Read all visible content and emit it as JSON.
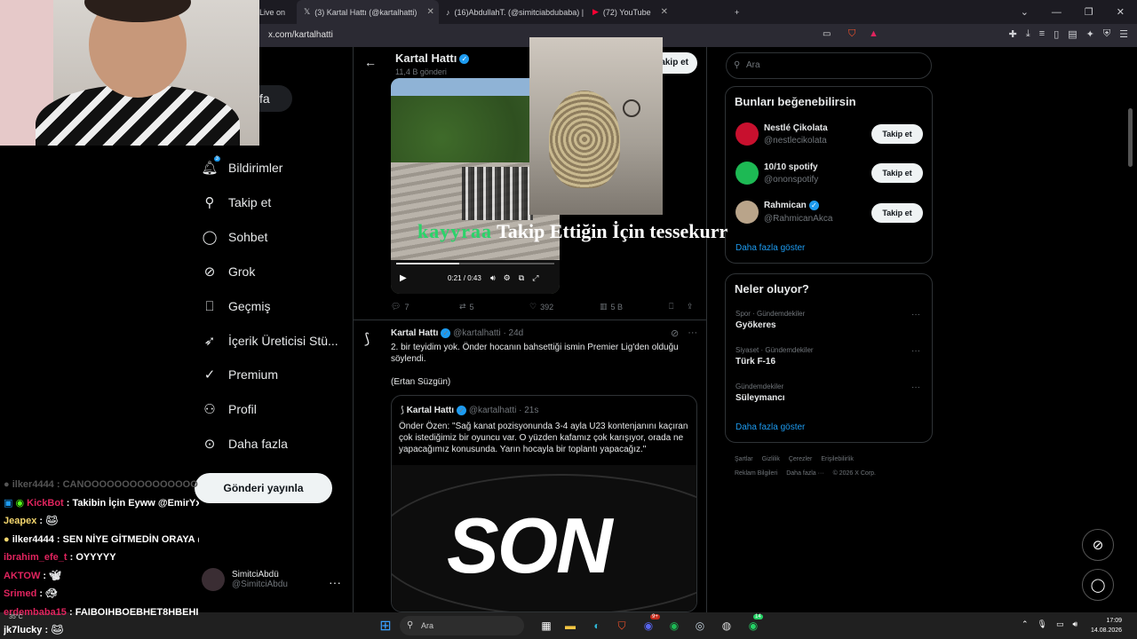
{
  "browser": {
    "tabs": [
      {
        "label": "Live on",
        "active": false
      },
      {
        "label": "(3) Kartal Hattı (@kartalhatti)",
        "active": true
      },
      {
        "label": "(16)AbdullahT. (@simitciabdubaba) |",
        "active": false
      },
      {
        "label": "(72) YouTube",
        "active": false
      }
    ],
    "url": "x.com/kartalhatti"
  },
  "nav": {
    "home": "yfa",
    "items": [
      {
        "label": "Bildirimler",
        "icon": "bell-icon"
      },
      {
        "label": "Takip et",
        "icon": "person-plus-icon"
      },
      {
        "label": "Sohbet",
        "icon": "chat-icon"
      },
      {
        "label": "Grok",
        "icon": "grok-icon"
      },
      {
        "label": "Geçmiş",
        "icon": "bookmark-icon"
      },
      {
        "label": "İçerik Üreticisi Stü...",
        "icon": "rocket-icon"
      },
      {
        "label": "Premium",
        "icon": "verified-icon"
      },
      {
        "label": "Profil",
        "icon": "person-icon"
      },
      {
        "label": "Daha fazla",
        "icon": "more-circle-icon"
      }
    ],
    "notif_badge": "3",
    "post_button": "Gönderi yayınla",
    "account": {
      "name": "SimitciAbdü",
      "handle": "@SimitciAbdu"
    }
  },
  "chat": [
    {
      "user": "ilker4444",
      "text": ": CANOOOOOOOOOOOOOOO",
      "color": "#555555",
      "faded": true
    },
    {
      "user": "KickBot",
      "text": ": Takibin İçin Eyww @EmirYxz",
      "color": "#e0245e"
    },
    {
      "user": "Jeapex",
      "text": ":",
      "color": "#f5d76e"
    },
    {
      "user": "ilker4444",
      "text": ": SEN NİYE GİTMEDİN ORAYA @simitciabdu",
      "color": "#ffffff"
    },
    {
      "user": "ibrahim_efe_t",
      "text": ": OYYYYY",
      "color": "#e0245e"
    },
    {
      "user": "AKTOW",
      "text": ":",
      "color": "#e0245e"
    },
    {
      "user": "Srimed",
      "text": ":",
      "color": "#e0245e"
    },
    {
      "user": "erdembaba15",
      "text": ": FAIBOIHBOEBHET8HBEHI",
      "color": "#e0245e"
    },
    {
      "user": "jk7lucky",
      "text": ":",
      "color": "#ffffff"
    }
  ],
  "profile": {
    "name": "Kartal Hattı",
    "sub": "11,4 B gönderi",
    "follow": "akip et"
  },
  "video": {
    "time": "0:21 / 0:43",
    "progress": 0.4
  },
  "overlay": {
    "green": "kayyraa",
    "white": "Takip Ettiğin İçin tessekurr"
  },
  "tweet1_actions": {
    "replies": "7",
    "retweets": "5",
    "likes": "392",
    "views": "5 B"
  },
  "tweet2": {
    "name": "Kartal Hattı",
    "handle": "@kartalhatti",
    "time": "· 24d",
    "body1": "2. bir teyidim yok. Önder hocanın bahsettiği ismin Premier Lig'den olduğu söylendi.",
    "body2": "(Ertan Süzgün)",
    "quote": {
      "name": "Kartal Hattı",
      "handle": "@kartalhatti",
      "time": "· 21s",
      "body": "Önder Özen: \"Sağ kanat pozisyonunda 3-4 ayla U23 kontenjanını kaçıran çok istediğimiz bir oyuncu var. O yüzden kafamız çok karışıyor, orada ne yapacağımız konusunda. Yarın hocayla bir toplantı yapacağız.\"",
      "image_text": "SON"
    }
  },
  "right": {
    "search_placeholder": "Ara",
    "suggest_title": "Bunları beğenebilirsin",
    "suggestions": [
      {
        "name": "Nestlé Çikolata",
        "handle": "@nestlecikolata",
        "color": "#c8102e",
        "button": "Takip et"
      },
      {
        "name": "10/10 spotify",
        "handle": "@ononspotify",
        "color": "#1db954",
        "button": "Takip et"
      },
      {
        "name": "Rahmican",
        "handle": "@RahmicanAkca",
        "color": "#b9a48a",
        "button": "Takip et"
      }
    ],
    "show_more": "Daha fazla göster",
    "trends_title": "Neler oluyor?",
    "trends": [
      {
        "category": "Spor · Gündemdekiler",
        "title": "Gyökeres"
      },
      {
        "category": "Siyaset · Gündemdekiler",
        "title": "Türk F-16"
      },
      {
        "category": "Gündemdekiler",
        "title": "Süleymancı"
      }
    ],
    "trends_more": "Daha fazla göster",
    "footer1": [
      "Şartlar",
      "Gizlilik",
      "Çerezler",
      "Erişilebilirlik"
    ],
    "footer2": [
      "Reklam Bilgileri",
      "Daha fazla ···",
      "© 2026 X Corp."
    ]
  },
  "taskbar": {
    "search": "Ara",
    "time": "17:09",
    "date": "14.08.2026",
    "weather": "35°C",
    "badge_discord": "9+",
    "badge_whatsapp": "14"
  }
}
